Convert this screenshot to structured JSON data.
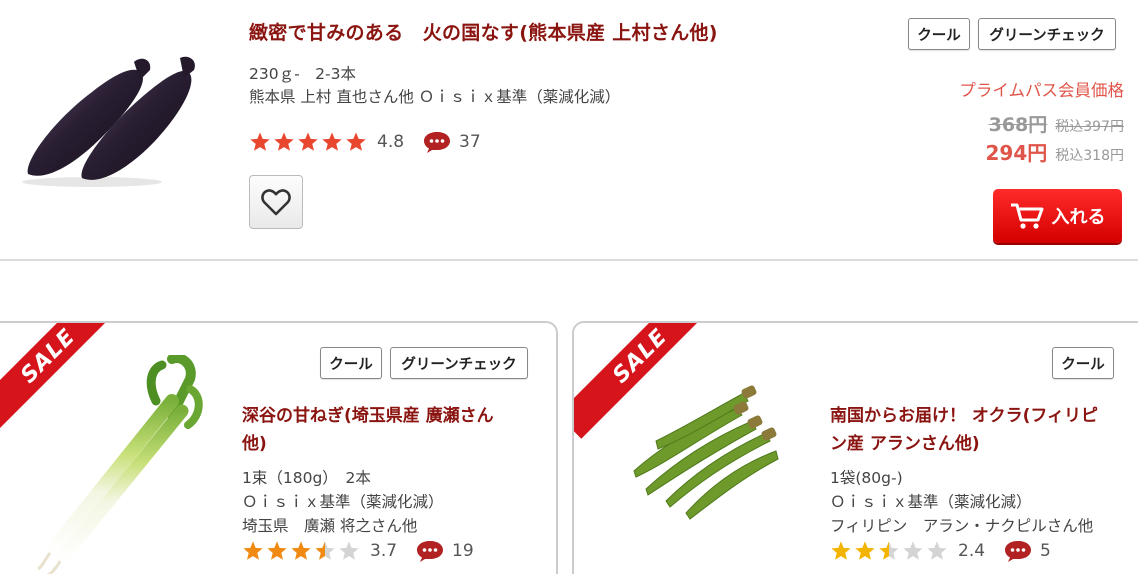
{
  "top_product": {
    "title": "緻密で甘みのある　火の国なす(熊本県産 上村さん他)",
    "spec1": "230ｇ-　2-3本",
    "spec2": "熊本県 上村 直也さん他 Ｏｉｓｉｘ基準（薬減化減）",
    "rating": "4.8",
    "rating_value": 4.8,
    "comments": "37",
    "tags": [
      "クール",
      "グリーンチェック"
    ],
    "member_label": "プライムパス会員価格",
    "price_regular": "368円",
    "price_regular_tax": "税込397円",
    "price_member": "294円",
    "price_member_tax": "税込318円",
    "cart_label": "入れる",
    "favorite_icon": "heart-icon",
    "image_icon": "eggplant-image"
  },
  "cards": [
    {
      "sale": "SALE",
      "tags": [
        "クール",
        "グリーンチェック"
      ],
      "title_line1": "深谷の甘ねぎ(埼玉県産 廣瀬さん",
      "title_line2": "他)",
      "spec1": "1束（180g）　2本",
      "spec2": "Ｏｉｓｉｘ基準（薬減化減）",
      "spec3": "埼玉県　廣瀬 将之さん他",
      "rating": "3.7",
      "rating_value": 3.7,
      "comments": "19",
      "image_icon": "green-onion-image"
    },
    {
      "sale": "SALE",
      "tags": [
        "クール"
      ],
      "title_line1": "南国からお届け！ オクラ(フィリピ",
      "title_line2": "ン産 アランさん他)",
      "spec1": "1袋(80g-)",
      "spec2": "Ｏｉｓｉｘ基準（薬減化減）",
      "spec3": "フィリピン　アラン・ナクピルさん他",
      "rating": "2.4",
      "rating_value": 2.4,
      "comments": "5",
      "image_icon": "okra-image"
    }
  ],
  "colors": {
    "star_top": "#e8462f",
    "star_onion": "#f08a12",
    "star_okra": "#f3b400",
    "star_empty": "#d4d4d4",
    "title": "#8a1410",
    "price": "#e0554a",
    "comment": "#b22222",
    "sale": "#d5141c"
  }
}
